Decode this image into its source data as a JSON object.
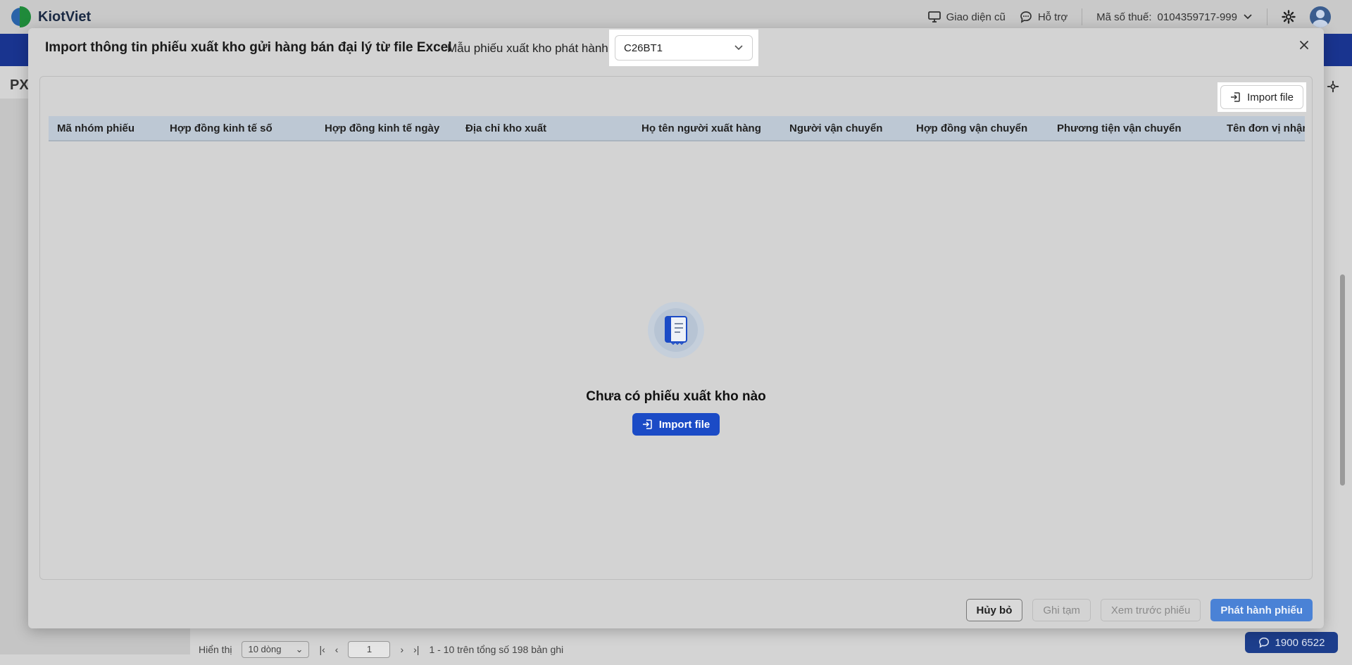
{
  "app": {
    "name": "KiotViet"
  },
  "topbar": {
    "old_ui": "Giao diện cũ",
    "support": "Hỗ trợ",
    "tax_label": "Mã số thuế:",
    "tax_value": "0104359717-999"
  },
  "background": {
    "page_title": "PX",
    "footer": {
      "show_label": "Hiển thị",
      "page_size": "10 dòng",
      "page": "1",
      "range": "1 - 10 trên tổng số 198 bản ghi"
    },
    "hotline": "1900 6522"
  },
  "modal": {
    "title": "Import thông tin phiếu xuất kho gửi hàng bán đại lý từ file Excel",
    "template_label": "Mẫu phiếu xuất kho phát hành",
    "template_value": "C26BT1",
    "import_top_label": "Import file",
    "columns": [
      "Mã nhóm phiếu",
      "Hợp đồng kinh tế số",
      "Hợp đồng kinh tế ngày",
      "Địa chỉ kho xuất",
      "Họ tên người xuất hàng",
      "Người vận chuyển",
      "Hợp đồng vận chuyển",
      "Phương tiện vận chuyển",
      "Tên đơn vị nhận"
    ],
    "empty_text": "Chưa có phiếu xuất kho nào",
    "import_center_label": "Import file",
    "buttons": {
      "cancel": "Hủy bỏ",
      "save_draft": "Ghi tạm",
      "preview": "Xem trước phiếu",
      "publish": "Phát hành phiếu"
    }
  },
  "colors": {
    "primary": "#1b4bc6",
    "publish": "#4a82d6",
    "header_band": "#19348f",
    "table_head": "#bdc8d4"
  }
}
